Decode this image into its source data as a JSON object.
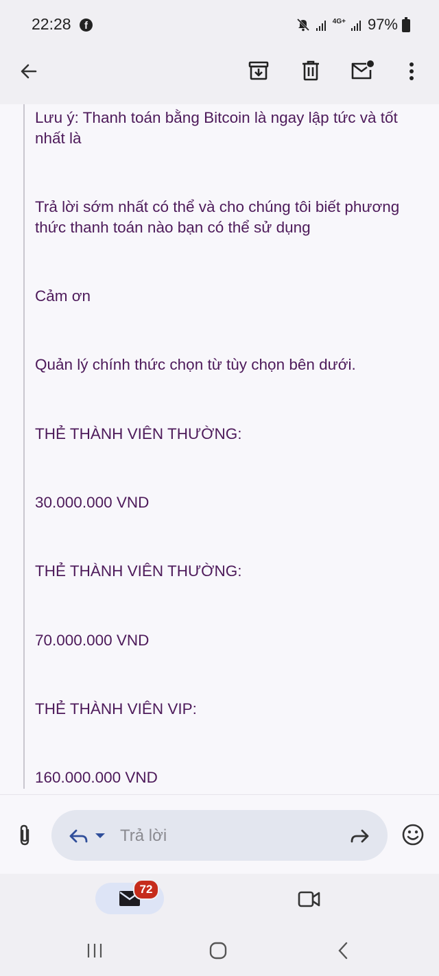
{
  "status_bar": {
    "time": "22:28",
    "battery": "97%",
    "network": "4G+",
    "icons": [
      "facebook-icon",
      "mute-icon",
      "signal-icon",
      "signal-icon",
      "battery-icon"
    ]
  },
  "toolbar": {
    "icons": [
      "back-arrow-icon",
      "archive-icon",
      "trash-icon",
      "mark-unread-icon",
      "more-vert-icon"
    ]
  },
  "email": {
    "paragraphs": [
      "Lưu ý: Thanh toán bằng Bitcoin là ngay lập tức và tốt nhất là",
      "Trả lời sớm nhất có thể và cho chúng tôi biết phương thức thanh toán nào bạn có thể sử dụng",
      "Cảm ơn",
      "Quản lý chính thức chọn từ tùy chọn bên dưới.",
      "THẺ THÀNH VIÊN THƯỜNG:",
      "30.000.000 VND",
      "THẺ THÀNH VIÊN THƯỜNG:",
      "70.000.000 VND",
      "THẺ THÀNH VIÊN VIP:",
      "160.000.000 VND"
    ]
  },
  "reply_bar": {
    "placeholder": "Trả lời"
  },
  "bottom_nav": {
    "mail_badge": "72"
  },
  "colors": {
    "text": "#4d1a5a",
    "badge": "#c62c1c",
    "selected_pill": "#dde4f6"
  }
}
